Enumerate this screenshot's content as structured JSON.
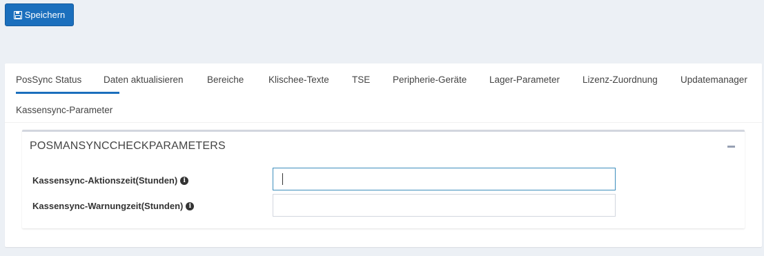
{
  "toolbar": {
    "save_label": "Speichern"
  },
  "tabs": [
    {
      "label": "PosSync Status",
      "active": true
    },
    {
      "label": "Daten aktualisieren"
    },
    {
      "label": "Bereiche"
    },
    {
      "label": "Klischee-Texte"
    },
    {
      "label": "TSE"
    },
    {
      "label": "Peripherie-Geräte"
    },
    {
      "label": "Lager-Parameter"
    },
    {
      "label": "Lizenz-Zuordnung"
    },
    {
      "label": "Updatemanager"
    },
    {
      "label": "Kassensync-Parameter"
    }
  ],
  "section": {
    "title": "POSMANSYNCCHECKPARAMETERS",
    "fields": [
      {
        "label": "Kassensync-Aktionszeit(Stunden)",
        "value": "",
        "placeholder": ""
      },
      {
        "label": "Kassensync-Warnungzeit(Stunden)",
        "value": "",
        "placeholder": ""
      }
    ]
  },
  "colors": {
    "primary": "#1b6fbd",
    "background": "#ecf0f5",
    "box_border": "#d2d6de"
  }
}
